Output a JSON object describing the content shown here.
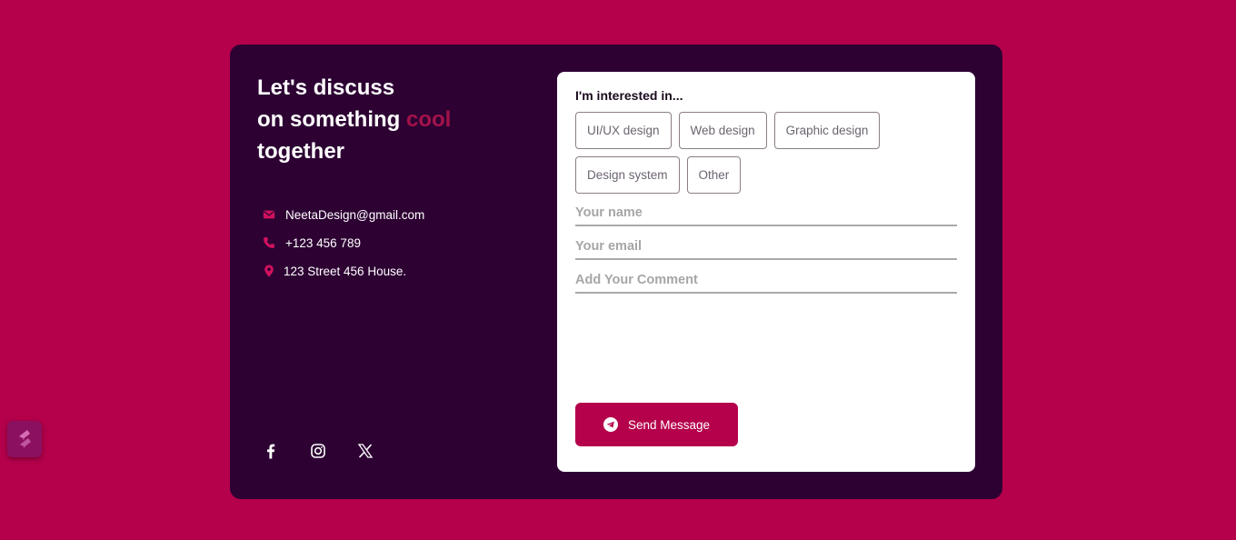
{
  "colors": {
    "page_bg": "#b5004b",
    "card_bg": "#2d0233",
    "accent": "#b5004b",
    "accent_text": "#a3124a",
    "form_bg": "#ffffff"
  },
  "hero": {
    "line1": "Let's discuss",
    "line2_prefix": "on something ",
    "line2_accent": "cool",
    "line3": "together"
  },
  "contacts": {
    "email": {
      "icon": "envelope-icon",
      "text": "NeetaDesign@gmail.com"
    },
    "phone": {
      "icon": "phone-icon",
      "text": "+123 456 789"
    },
    "address": {
      "icon": "location-pin-icon",
      "text": "123 Street 456 House."
    }
  },
  "socials": [
    {
      "icon": "facebook-icon"
    },
    {
      "icon": "instagram-icon"
    },
    {
      "icon": "x-twitter-icon"
    }
  ],
  "form": {
    "interest_label": "I'm interested in...",
    "options": [
      "UI/UX design",
      "Web design",
      "Graphic design",
      "Design system",
      "Other"
    ],
    "name_placeholder": "Your name",
    "email_placeholder": "Your email",
    "comment_placeholder": "Add Your Comment",
    "submit_label": "Send Message",
    "submit_icon": "telegram-send-icon"
  },
  "widget": {
    "icon": "builder-logo-icon"
  }
}
